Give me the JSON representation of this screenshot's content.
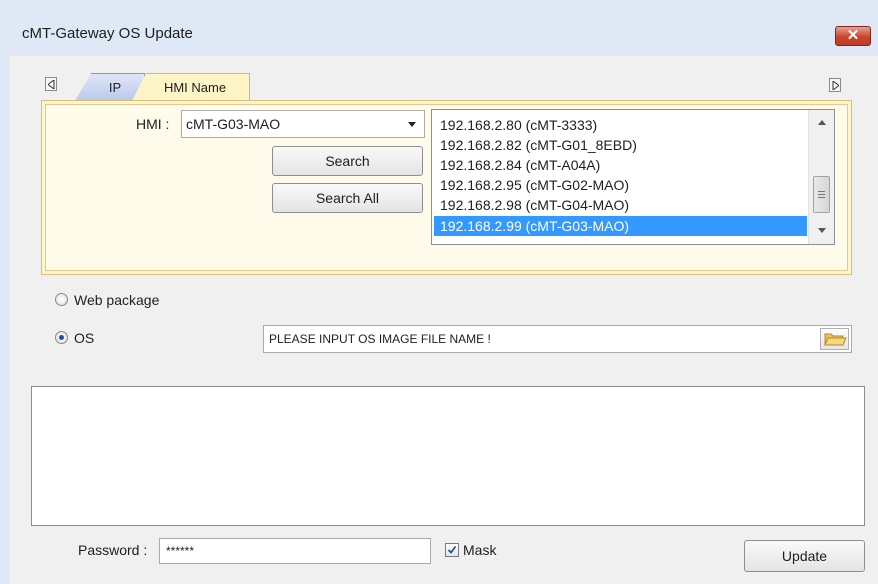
{
  "window": {
    "title": "cMT-Gateway OS Update",
    "close_glyph": "✕"
  },
  "tabs": [
    {
      "label": "IP",
      "active": false
    },
    {
      "label": "HMI Name",
      "active": true
    }
  ],
  "hmi": {
    "label": "HMI :",
    "selected": "cMT-G03-MAO",
    "search_label": "Search",
    "search_all_label": "Search All",
    "list": [
      "192.168.2.80 (cMT-3333)",
      "192.168.2.82 (cMT-G01_8EBD)",
      "192.168.2.84 (cMT-A04A)",
      "192.168.2.95 (cMT-G02-MAO)",
      "192.168.2.98 (cMT-G04-MAO)",
      "192.168.2.99 (cMT-G03-MAO)"
    ],
    "selected_index": 5
  },
  "mode": {
    "web_package_label": "Web package",
    "os_label": "OS",
    "selected": "OS",
    "os_path_placeholder": "PLEASE INPUT OS IMAGE FILE NAME !"
  },
  "footer": {
    "password_label": "Password :",
    "password_value": "******",
    "mask_label": "Mask",
    "mask_checked": true,
    "update_label": "Update"
  },
  "colors": {
    "title_bar": "#dfe9f6",
    "close_button": "#c9462c",
    "tab_panel": "#fff5c9",
    "selection": "#3399ff"
  },
  "icons": {
    "close": "close-icon",
    "tab_scroll_left": "triangle-left-icon",
    "tab_scroll_right": "triangle-right-icon",
    "folder": "folder-icon"
  }
}
